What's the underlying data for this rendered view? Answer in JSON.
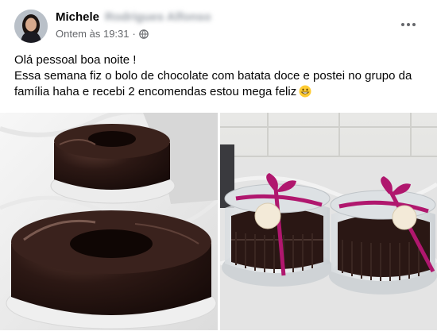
{
  "post": {
    "author_name": "Michele",
    "author_surname_blurred": "Rodrigues Alfonso",
    "timestamp": "Ontem às 19:31",
    "separator": "·",
    "privacy_icon": "globe-icon",
    "more_icon": "more-options-icon",
    "text_line1": "Olá pessoal boa noite !",
    "text_line2": "Essa semana fiz o bolo de chocolate com batata doce e postei no grupo da família haha e recebi 2 encomendas estou mega feliz",
    "emoji": "grinning-face-emoji"
  },
  "photos": {
    "left": {
      "subject": "two chocolate bundt cakes on white plates"
    },
    "right": {
      "subject": "two packaged chocolate cakes with pink ribbons"
    }
  },
  "colors": {
    "text": "#050505",
    "secondary_text": "#65676b",
    "ribbon": "#b0176e",
    "chocolate": "#2a1612"
  }
}
